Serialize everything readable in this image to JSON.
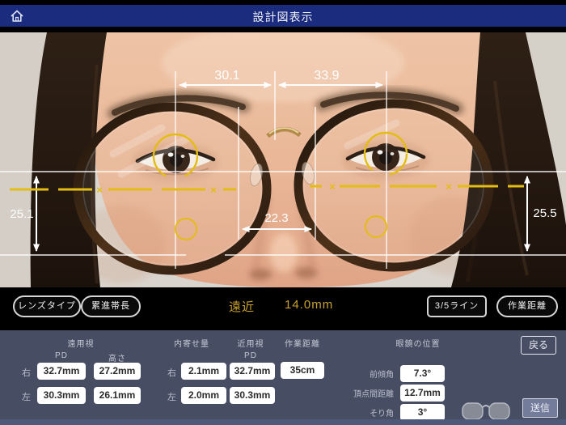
{
  "titlebar": {
    "title": "設計図表示",
    "home_icon": "home"
  },
  "overlay": {
    "top_left_value": "30.1",
    "top_right_value": "33.9",
    "side_left_value": "25.1",
    "side_right_value": "25.5",
    "center_value": "22.3",
    "cross": "×"
  },
  "controls": {
    "lens_type_label": "レンズタイプ",
    "corridor_label": "累進帯長",
    "mode_label": "遠近",
    "mode_value": "14.0mm",
    "lines_label": "3/5ライン",
    "work_distance_label": "作業距離"
  },
  "panel": {
    "far_vision_header": "遠用視",
    "pd_header": "PD",
    "height_header": "高さ",
    "inset_header": "内寄せ量",
    "near_vision_header": "近用視",
    "near_pd_header": "PD",
    "work_distance_header": "作業距離",
    "glasses_position_header": "眼鏡の位置",
    "right_label": "右",
    "left_label": "左",
    "far_pd_right": "32.7mm",
    "far_height_right": "27.2mm",
    "far_pd_left": "30.3mm",
    "far_height_left": "26.1mm",
    "inset_right": "2.1mm",
    "inset_left": "2.0mm",
    "near_pd_right": "32.7mm",
    "near_pd_left": "30.3mm",
    "work_distance_value": "35cm",
    "pantoscopic_label": "前傾角",
    "pantoscopic_value": "7.3°",
    "vertex_label": "頂点間距離",
    "vertex_value": "12.7mm",
    "wrap_label": "そり角",
    "wrap_value": "3°",
    "back_label": "戻る",
    "send_label": "送信"
  },
  "colors": {
    "titlebar_blue": "#1b2b7d",
    "accent_gold": "#c9a12c",
    "overlay_yellow": "#e3bd14",
    "panel_bg": "#474d62",
    "bottom_strip": "#4e5878",
    "value_box": "#ffffff"
  }
}
